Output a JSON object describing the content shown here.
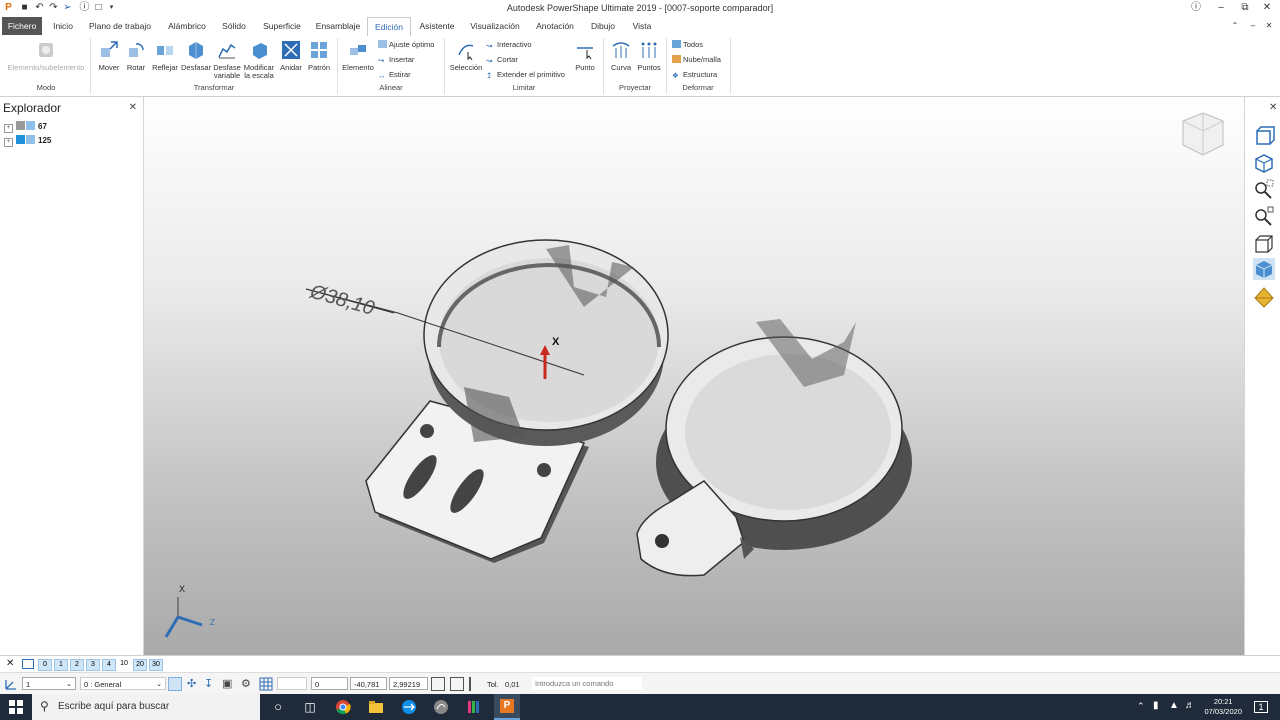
{
  "window": {
    "title": "Autodesk PowerShape Ultimate 2019 - [0007-soporte comparador]",
    "quick_access_icons": [
      "app-icon",
      "save-icon",
      "undo-icon",
      "redo-icon",
      "select-icon",
      "info-icon",
      "new-icon",
      "dropdown-icon"
    ],
    "controls": [
      "help-icon",
      "minimize-icon",
      "maximize-icon",
      "close-icon"
    ]
  },
  "tabs": [
    {
      "label": "Fichero"
    },
    {
      "label": "Inicio"
    },
    {
      "label": "Plano de trabajo"
    },
    {
      "label": "Alámbrico"
    },
    {
      "label": "Sólido"
    },
    {
      "label": "Superficie"
    },
    {
      "label": "Ensamblaje"
    },
    {
      "label": "Edición"
    },
    {
      "label": "Asistente"
    },
    {
      "label": "Visualización"
    },
    {
      "label": "Anotación"
    },
    {
      "label": "Dibujo"
    },
    {
      "label": "Vista"
    }
  ],
  "active_tab": "Edición",
  "ribbon": {
    "modo": {
      "button": "Elemento/subelemento",
      "group": "Modo"
    },
    "transformar": {
      "buttons": [
        {
          "label": "Mover"
        },
        {
          "label": "Rotar"
        },
        {
          "label": "Reflejar"
        },
        {
          "label": "Desfasar"
        },
        {
          "label": "Desfase variable"
        },
        {
          "label": "Modificar la escala"
        },
        {
          "label": "Anidar"
        },
        {
          "label": "Patrón"
        }
      ],
      "group": "Transformar"
    },
    "alinear": {
      "button": "Elemento",
      "small": [
        {
          "label": "Ajuste óptimo"
        },
        {
          "label": "Insertar"
        },
        {
          "label": "Estirar"
        }
      ],
      "group": "Alinear"
    },
    "limitar": {
      "button": "Selección",
      "small": [
        {
          "label": "Interactivo"
        },
        {
          "label": "Cortar"
        },
        {
          "label": "Extender el primitivo"
        }
      ],
      "button2": "Punto",
      "group": "Limitar"
    },
    "proyectar": {
      "buttons": [
        {
          "label": "Curva"
        },
        {
          "label": "Puntos"
        }
      ],
      "group": "Proyectar"
    },
    "deformar": {
      "small": [
        {
          "label": "Todos"
        },
        {
          "label": "Nube/malla"
        },
        {
          "label": "Estructura"
        }
      ],
      "group": "Deformar"
    }
  },
  "explorer": {
    "title": "Explorador",
    "items": [
      {
        "label": "67"
      },
      {
        "label": "125"
      }
    ]
  },
  "viewport": {
    "dimension_label": "Ø38,10",
    "axis_label": "X",
    "triad_label": "X",
    "triad_z": "Z"
  },
  "levels": {
    "items": [
      "0",
      "1",
      "2",
      "3",
      "4",
      "10",
      "20",
      "30"
    ]
  },
  "statusbar": {
    "workplane": "1",
    "layer": "0 : General",
    "coord_x": "0",
    "coord_y": "-40,781",
    "coord_z": "2,99219",
    "tol_label": "Tol.",
    "tol_value": "0,01",
    "command_placeholder": "Introduzca un comando"
  },
  "taskbar": {
    "search_placeholder": "Escribe aquí para buscar",
    "time": "20:21",
    "date": "07/03/2020",
    "notifications": "1"
  }
}
